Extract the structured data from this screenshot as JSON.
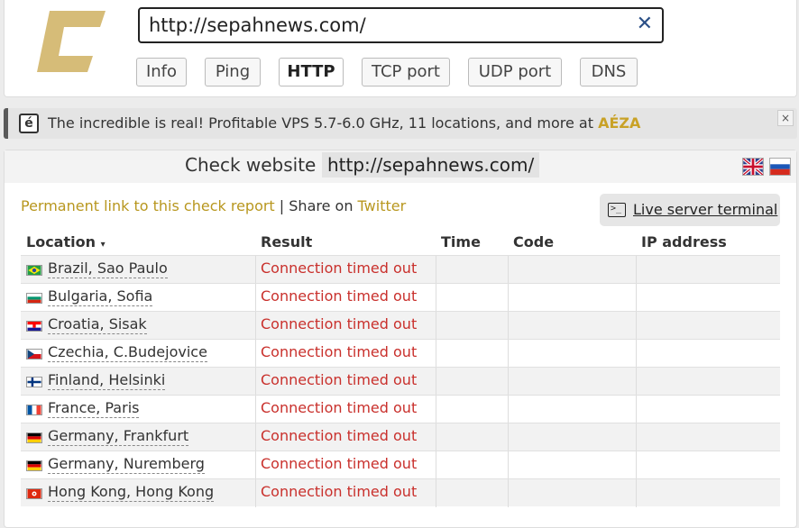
{
  "search": {
    "url_value": "http://sepahnews.com/"
  },
  "tabs": [
    {
      "label": "Info",
      "active": false
    },
    {
      "label": "Ping",
      "active": false
    },
    {
      "label": "HTTP",
      "active": true
    },
    {
      "label": "TCP port",
      "active": false
    },
    {
      "label": "UDP port",
      "active": false
    },
    {
      "label": "DNS",
      "active": false
    }
  ],
  "ad": {
    "badge": "é",
    "text": "The incredible is real! Profitable VPS 5.7-6.0 GHz, 11 locations, and more at ",
    "brand": "AÉZA",
    "close": "×"
  },
  "check": {
    "label": "Check website",
    "url": "http://sepahnews.com/",
    "permalink": "Permanent link to this check report",
    "separator": " | ",
    "share_prefix": "Share on ",
    "share_target": "Twitter",
    "terminal_label": "Live server terminal",
    "terminal_icon": ">_"
  },
  "table": {
    "headers": {
      "location": "Location",
      "sort_indicator": "▾",
      "result": "Result",
      "time": "Time",
      "code": "Code",
      "ip": "IP address"
    },
    "rows": [
      {
        "location": "Brazil, Sao Paulo",
        "result": "Connection timed out",
        "flag": "brazil-flag-icon"
      },
      {
        "location": "Bulgaria, Sofia",
        "result": "Connection timed out",
        "flag": "bulgaria-flag-icon"
      },
      {
        "location": "Croatia, Sisak",
        "result": "Connection timed out",
        "flag": "croatia-flag-icon"
      },
      {
        "location": "Czechia, C.Budejovice",
        "result": "Connection timed out",
        "flag": "czechia-flag-icon"
      },
      {
        "location": "Finland, Helsinki",
        "result": "Connection timed out",
        "flag": "finland-flag-icon"
      },
      {
        "location": "France, Paris",
        "result": "Connection timed out",
        "flag": "france-flag-icon"
      },
      {
        "location": "Germany, Frankfurt",
        "result": "Connection timed out",
        "flag": "germany-flag-icon"
      },
      {
        "location": "Germany, Nuremberg",
        "result": "Connection timed out",
        "flag": "germany-flag-icon"
      },
      {
        "location": "Hong Kong, Hong Kong",
        "result": "Connection timed out",
        "flag": "hongkong-flag-icon"
      }
    ]
  },
  "colors": {
    "brand_gold": "#c9a227",
    "error_red": "#c9302c",
    "link_gold": "#b8971f"
  }
}
